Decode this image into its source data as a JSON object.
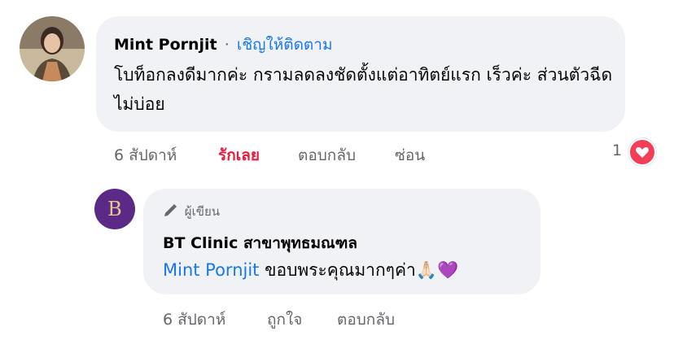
{
  "comment": {
    "author": "Mint Pornjit",
    "separator": "·",
    "follow_label": "เชิญให้ติดตาม",
    "text": "โบท็อกลงดีมากค่ะ กรามลดลงชัดตั้งแต่อาทิตย์แรก เร็วค่ะ ส่วนตัวฉีดไม่บ่อย",
    "time": "6 สัปดาห์",
    "like_label": "รักเลย",
    "reply_label": "ตอบกลับ",
    "hide_label": "ซ่อน",
    "reaction_count": "1",
    "reaction_icon": "love-reaction-icon"
  },
  "reply": {
    "badge_label": "ผู้เขียน",
    "badge_icon": "pen-icon",
    "author": "BT Clinic สาขาพุทธมณฑล",
    "logo_text": "B",
    "mention": "Mint Pornjit",
    "text": " ขอบพระคุณมากๆค่า🙏🏻💜",
    "time": "6 สัปดาห์",
    "like_label": "ถูกใจ",
    "reply_label": "ตอบกลับ"
  }
}
